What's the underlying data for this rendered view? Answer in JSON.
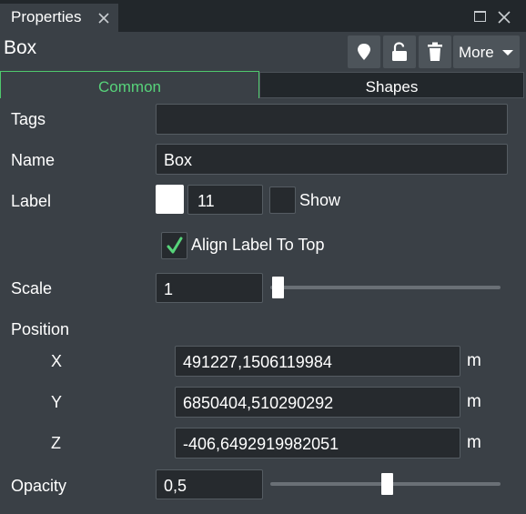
{
  "window": {
    "tab_label": "Properties"
  },
  "header": {
    "title": "Box",
    "more_label": "More"
  },
  "tabs": [
    {
      "label": "Common",
      "active": true
    },
    {
      "label": "Shapes",
      "active": false
    }
  ],
  "form": {
    "tags": {
      "label": "Tags",
      "value": ""
    },
    "name": {
      "label": "Name",
      "value": "Box"
    },
    "label": {
      "label": "Label",
      "color": "#ffffff",
      "size": "11",
      "show_label": "Show",
      "show_checked": false
    },
    "align_top": {
      "label": "Align Label To Top",
      "checked": true
    },
    "scale": {
      "label": "Scale",
      "value": "1",
      "slider_fraction": 0.0
    },
    "position": {
      "label": "Position",
      "x": {
        "label": "X",
        "value": "491227,1506119984",
        "unit": "m"
      },
      "y": {
        "label": "Y",
        "value": "6850404,510290292",
        "unit": "m"
      },
      "z": {
        "label": "Z",
        "value": "-406,6492919982051",
        "unit": "m"
      }
    },
    "opacity": {
      "label": "Opacity",
      "value": "0,5",
      "slider_fraction": 0.5
    }
  },
  "colors": {
    "accent": "#57d37a",
    "panel_bg": "#3a4046",
    "tabbar_bg": "#22272b",
    "field_bg": "#262a2e"
  },
  "icons": [
    "close-icon",
    "maximize-icon",
    "pin-icon",
    "unlock-icon",
    "trash-icon",
    "chevron-down-icon",
    "checkmark-icon"
  ]
}
